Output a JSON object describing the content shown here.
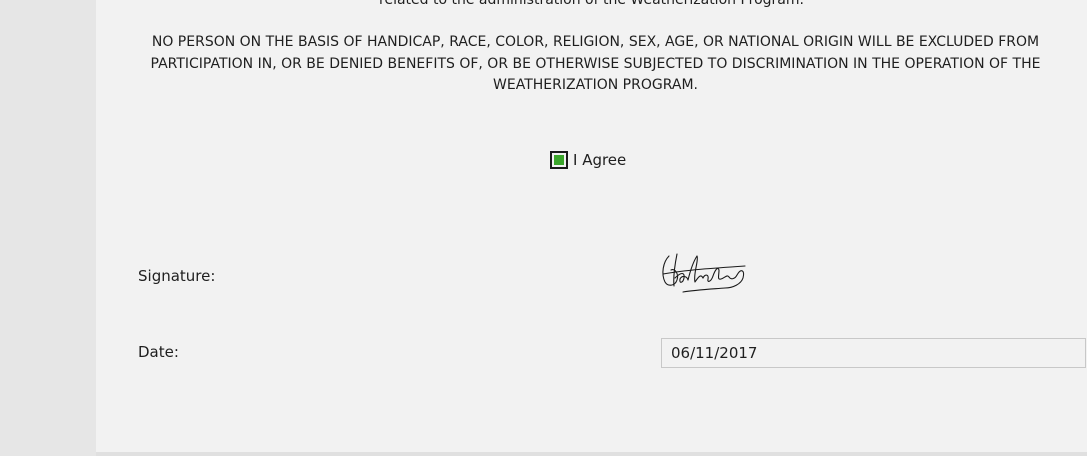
{
  "document": {
    "clipped_text": "related to the administration of the Weatherization Program.",
    "notice_text": "NO PERSON ON THE BASIS OF HANDICAP, RACE, COLOR, RELIGION, SEX, AGE, OR NATIONAL ORIGIN WILL BE EXCLUDED FROM PARTICIPATION IN, OR BE DENIED BENEFITS OF, OR BE OTHERWISE SUBJECTED TO DISCRIMINATION IN THE OPERATION OF THE WEATHERIZATION PROGRAM."
  },
  "agree": {
    "label": "I Agree",
    "checked": true,
    "check_color": "#3aa52a"
  },
  "signature": {
    "label": "Signature:",
    "icon": "handwritten-signature"
  },
  "date": {
    "label": "Date:",
    "value": "06/11/2017"
  }
}
